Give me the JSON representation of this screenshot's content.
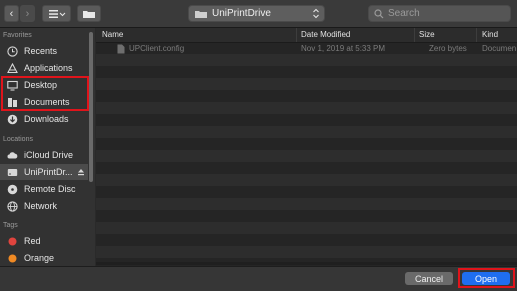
{
  "toolbar": {
    "path_label": "UniPrintDrive",
    "search_placeholder": "Search"
  },
  "sidebar": {
    "favorites_label": "Favorites",
    "locations_label": "Locations",
    "tags_label": "Tags",
    "favorites": [
      {
        "label": "Recents",
        "icon": "clock-icon"
      },
      {
        "label": "Applications",
        "icon": "applications-icon"
      },
      {
        "label": "Desktop",
        "icon": "desktop-icon"
      },
      {
        "label": "Documents",
        "icon": "documents-icon"
      },
      {
        "label": "Downloads",
        "icon": "downloads-icon"
      }
    ],
    "locations": [
      {
        "label": "iCloud Drive",
        "icon": "cloud-icon"
      },
      {
        "label": "UniPrintDr...",
        "icon": "drive-icon"
      },
      {
        "label": "Remote Disc",
        "icon": "disc-icon"
      },
      {
        "label": "Network",
        "icon": "globe-icon"
      }
    ],
    "tags": [
      {
        "label": "Red",
        "color": "#e0443e"
      },
      {
        "label": "Orange",
        "color": "#f08a24"
      }
    ]
  },
  "list": {
    "columns": [
      "Name",
      "Date Modified",
      "Size",
      "Kind"
    ],
    "rows": [
      {
        "name": "UPClient.config",
        "date": "Nov 1, 2019 at 5:33 PM",
        "size": "Zero bytes",
        "kind": "Documen"
      }
    ]
  },
  "buttons": {
    "cancel": "Cancel",
    "open": "Open"
  },
  "colors": {
    "accent": "#1f6ef0",
    "highlight": "#e0141b"
  }
}
